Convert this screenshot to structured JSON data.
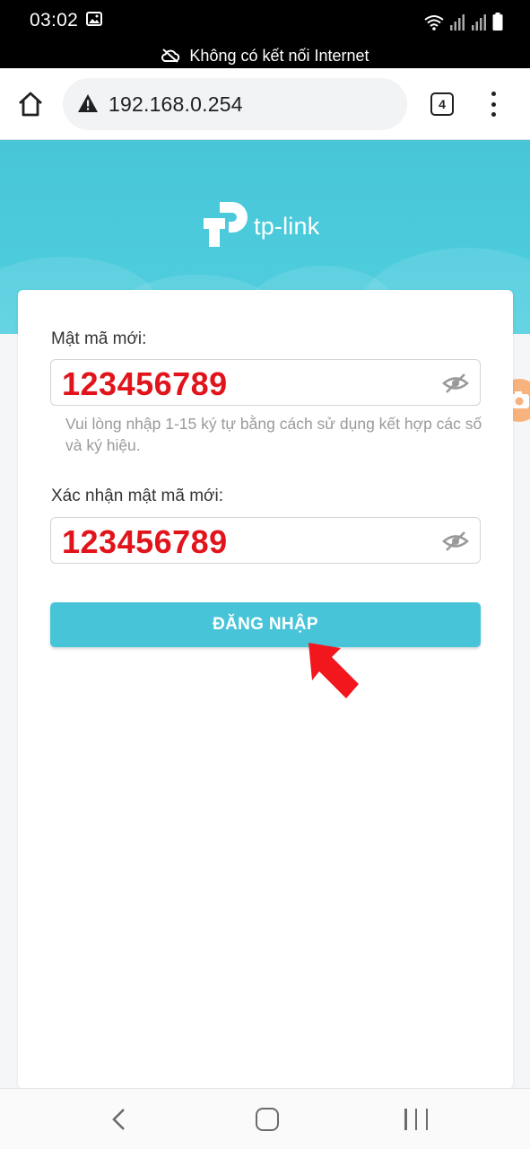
{
  "status_bar": {
    "time": "03:02",
    "icons": [
      "image-icon",
      "wifi-icon",
      "signal-icon",
      "signal-icon",
      "battery-icon"
    ]
  },
  "offline_banner": {
    "icon": "cloud-off-icon",
    "text": "Không có kết nối Internet"
  },
  "browser": {
    "url": "192.168.0.254",
    "security_icon": "warning-icon",
    "tab_count": "4"
  },
  "brand": {
    "logo_text": "tp-link",
    "accent_color": "#4ac7d9"
  },
  "form": {
    "new_password": {
      "label": "Mật mã mới:",
      "value": "123456789"
    },
    "hint": "Vui lòng nhập 1-15 ký tự bằng cách sử dụng kết hợp các số và ký hiệu.",
    "confirm_password": {
      "label": "Xác nhận mật mã mới:",
      "value": "123456789"
    },
    "submit_label": "ĐĂNG NHẬP"
  },
  "colors": {
    "password_text": "#e1141b",
    "button": "#48c4d8",
    "annotation_arrow": "#f2161d"
  }
}
